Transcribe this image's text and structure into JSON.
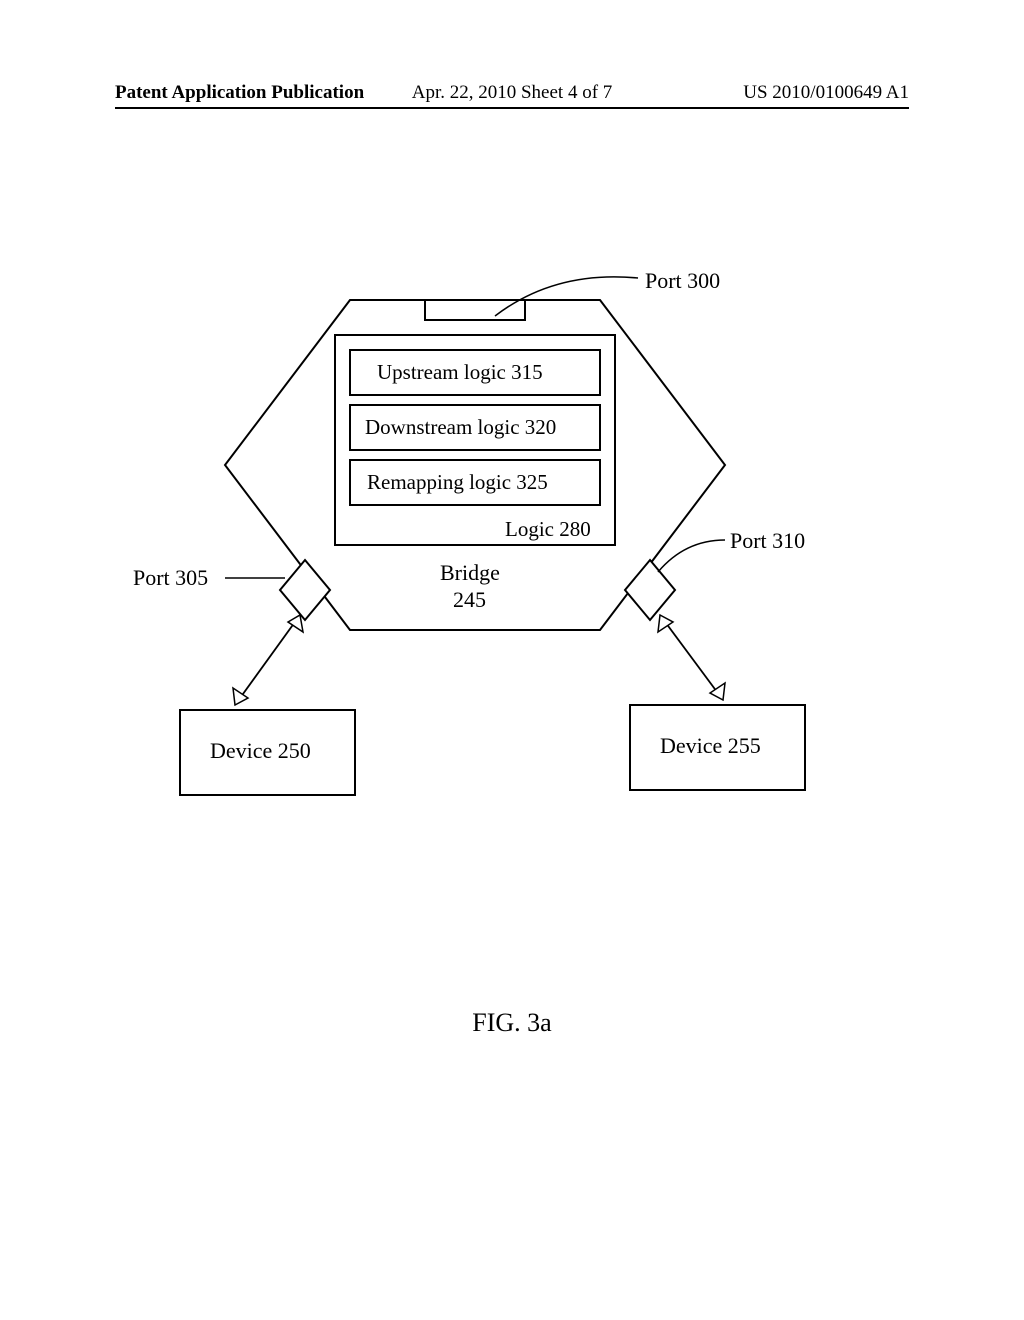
{
  "header": {
    "left": "Patent Application Publication",
    "center": "Apr. 22, 2010  Sheet 4 of 7",
    "right": "US 2010/0100649 A1"
  },
  "diagram": {
    "port_top": "Port 300",
    "port_left": "Port 305",
    "port_right": "Port 310",
    "logic_container": "Logic 280",
    "upstream": "Upstream logic 315",
    "downstream": "Downstream logic 320",
    "remapping": "Remapping logic 325",
    "bridge_line1": "Bridge",
    "bridge_line2": "245",
    "device_left": "Device 250",
    "device_right": "Device 255"
  },
  "figure": "FIG. 3a"
}
